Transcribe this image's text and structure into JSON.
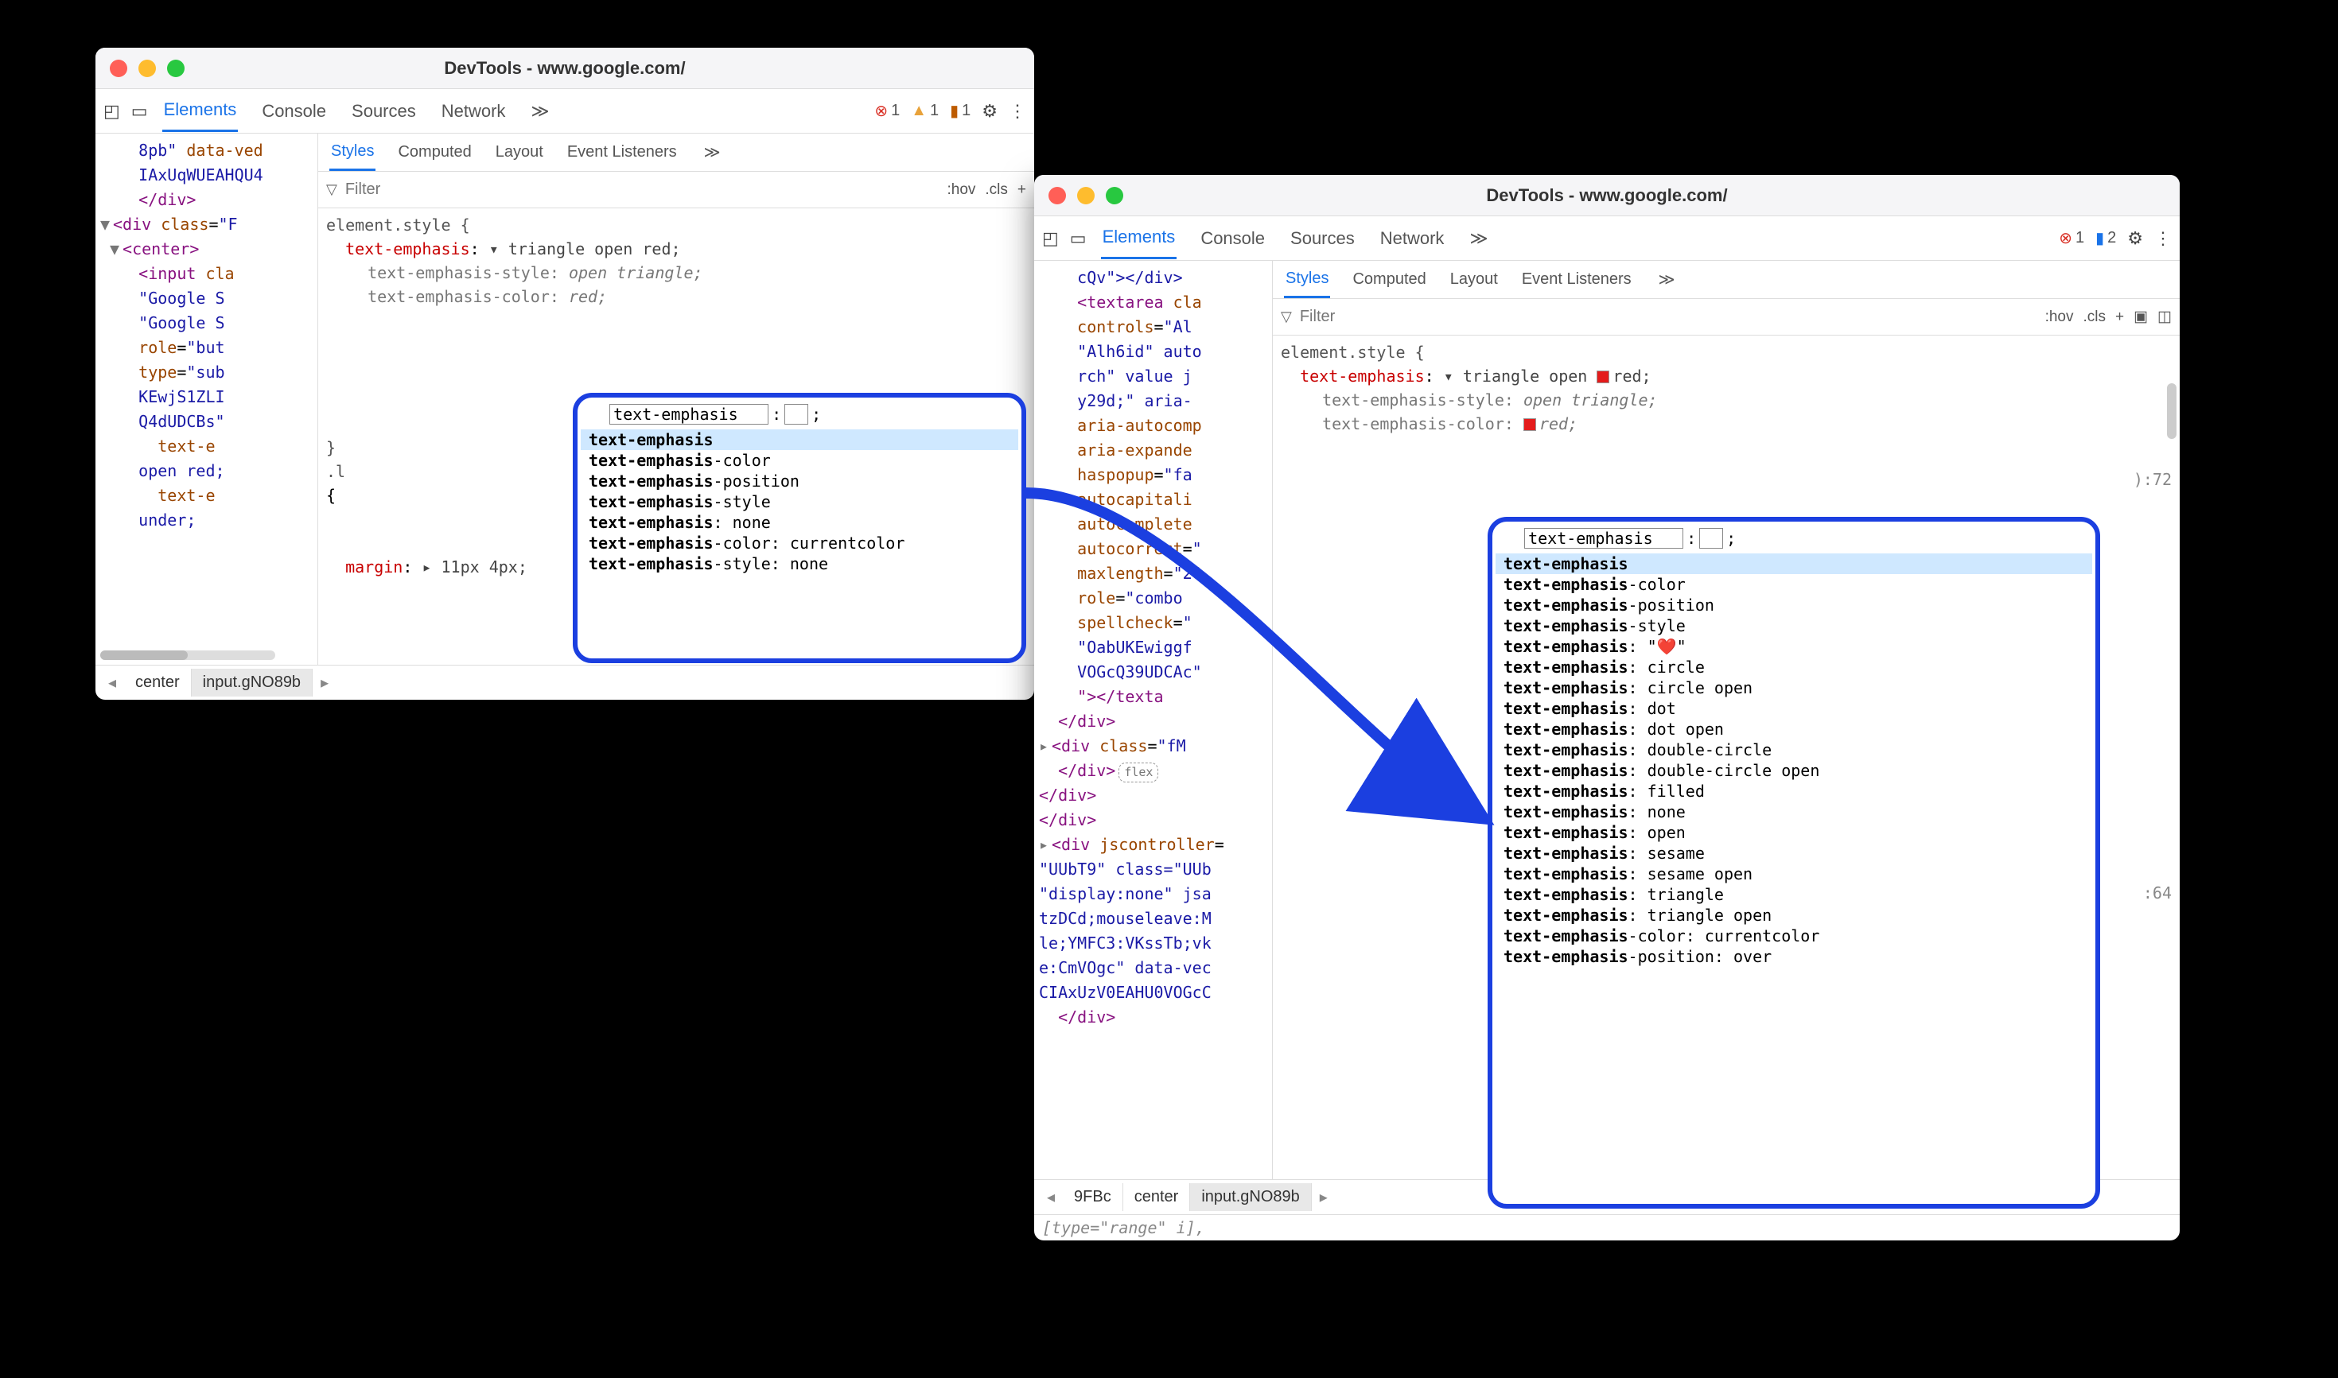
{
  "windows": {
    "left": {
      "title": "DevTools - www.google.com/",
      "tabs": {
        "elements": "Elements",
        "console": "Console",
        "sources": "Sources",
        "network": "Network"
      },
      "indicators": {
        "errors": "1",
        "warnings": "1",
        "issues": "1"
      },
      "subtabs": {
        "styles": "Styles",
        "computed": "Computed",
        "layout": "Layout",
        "listeners": "Event Listeners"
      },
      "filter_placeholder": "Filter",
      "filter_hov": ":hov",
      "filter_cls": ".cls",
      "dom": {
        "l1a": "8pb\"",
        "l1b": "data-ved",
        "l1c": "IAxUqWUEAHQU4",
        "l2": "</div>",
        "l3a": "<div",
        "l3b": "class",
        "l3c": "\"F",
        "l4": "<center>",
        "l5a": "<input",
        "l5b": "cla",
        "l6": "\"Google S",
        "l7": "\"Google S",
        "l8a": "role",
        "l8b": "\"but",
        "l9a": "type",
        "l9b": "\"sub",
        "l10": "KEwjS1ZLI",
        "l11": "Q4dUDCBs\"",
        "l12": "text-e",
        "l13": "open red;",
        "l14": "text-e",
        "l15": "under;"
      },
      "crumbs": {
        "c1": "center",
        "c2": "input.gNO89b"
      },
      "styles": {
        "selector": "element.style {",
        "p1_prop": "text-emphasis",
        "p1_val": "▾ triangle open red;",
        "s1_prop": "text-emphasis-style",
        "s1_val": "open triangle;",
        "s2_prop": "text-emphasis-color",
        "s2_val": "red;",
        "margin_prop": "margin",
        "margin_val": "▸ 11px 4px;",
        "close": "}",
        "rule2_sel": ".l"
      },
      "ac_input": "text-emphasis",
      "ac": [
        "text-emphasis",
        "text-emphasis-color",
        "text-emphasis-position",
        "text-emphasis-style",
        "text-emphasis: none",
        "text-emphasis-color: currentcolor",
        "text-emphasis-style: none"
      ]
    },
    "right": {
      "title": "DevTools - www.google.com/",
      "tabs": {
        "elements": "Elements",
        "console": "Console",
        "sources": "Sources",
        "network": "Network"
      },
      "indicators": {
        "errors": "1",
        "messages": "2"
      },
      "subtabs": {
        "styles": "Styles",
        "computed": "Computed",
        "layout": "Layout",
        "listeners": "Event Listeners"
      },
      "filter_placeholder": "Filter",
      "filter_hov": ":hov",
      "filter_cls": ".cls",
      "dom": {
        "l1": "cQv\"></div>",
        "l2a": "<textarea",
        "l2b": "cla",
        "l3a": "controls",
        "l3b": "\"Al",
        "l4": "\"Alh6id\" auto",
        "l5": "rch\" value j",
        "l6": "y29d;\" aria-",
        "l7": "aria-autocomp",
        "l8": "aria-expande",
        "l9a": "haspopup",
        "l9b": "\"fa",
        "l10": "autocapitali",
        "l11": "autocomplete",
        "l12a": "autocorrect",
        "l12b": "\"",
        "l13a": "maxlength",
        "l13b": "\"20",
        "l14a": "role",
        "l14b": "\"combo",
        "l15a": "spellcheck",
        "l15b": "\"",
        "l16": "\"OabUKEwiggf",
        "l17": "VOGcQ39UDCAc\"",
        "l18": "\"></texta",
        "l19": "</div>",
        "l20a": "<div",
        "l20b": "class",
        "l20c": "\"fM",
        "l21": "</div>",
        "l22": "</div>",
        "l23": "</div>",
        "l24a": "<div",
        "l24b": "jscontroller",
        "l25": "\"UUbT9\" class=\"UUb",
        "l26": "\"display:none\" jsa",
        "l27": "tzDCd;mouseleave:M",
        "l28": "le;YMFC3:VKssTb;vk",
        "l29": "e:CmVOgc\" data-vec",
        "l30": "CIAxUzV0EAHU0VOGcC",
        "l31": "</div>"
      },
      "crumbs": {
        "c0": "9FBc",
        "c1": "center",
        "c2": "input.gNO89b"
      },
      "bottomline": "[type=\"range\" i],",
      "styles": {
        "selector": "element.style {",
        "p1_prop": "text-emphasis",
        "p1_val": "▾ triangle open",
        "p1_red": "red;",
        "s1_prop": "text-emphasis-style",
        "s1_val": "open triangle;",
        "s2_prop": "text-emphasis-color",
        "s2_val": "red;",
        "right1": "):72",
        "right2": ":64"
      },
      "ac_input": "text-emphasis",
      "ac": [
        "text-emphasis",
        "text-emphasis-color",
        "text-emphasis-position",
        "text-emphasis-style",
        "text-emphasis: \"❤️\"",
        "text-emphasis: circle",
        "text-emphasis: circle open",
        "text-emphasis: dot",
        "text-emphasis: dot open",
        "text-emphasis: double-circle",
        "text-emphasis: double-circle open",
        "text-emphasis: filled",
        "text-emphasis: none",
        "text-emphasis: open",
        "text-emphasis: sesame",
        "text-emphasis: sesame open",
        "text-emphasis: triangle",
        "text-emphasis: triangle open",
        "text-emphasis-color: currentcolor",
        "text-emphasis-position: over"
      ]
    }
  },
  "flex_label": "flex"
}
